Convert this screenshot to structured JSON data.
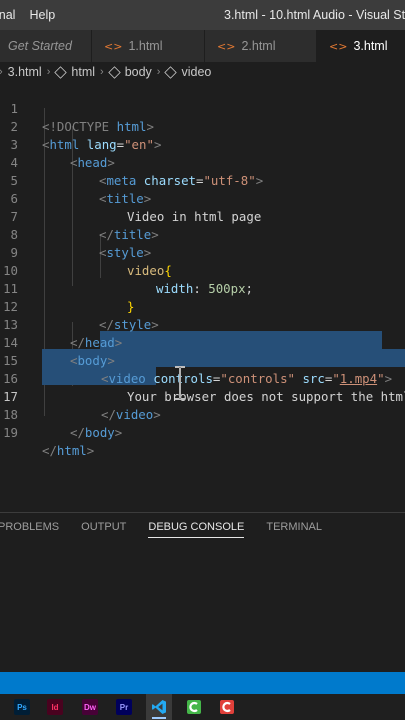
{
  "titlebar": {
    "menu": [
      "inal",
      "Help"
    ],
    "window_title": "3.html - 10.html Audio - Visual Studi"
  },
  "tabs": [
    {
      "label": "Get Started",
      "active": false
    },
    {
      "label": "1.html",
      "active": false
    },
    {
      "label": "2.html",
      "active": false
    },
    {
      "label": "3.html",
      "active": true
    }
  ],
  "breadcrumb": [
    "3.html",
    "html",
    "body",
    "video"
  ],
  "editor": {
    "current_line": "17",
    "line_numbers": [
      "1",
      "2",
      "3",
      "4",
      "5",
      "6",
      "7",
      "8",
      "9",
      "10",
      "11",
      "12",
      "13",
      "14",
      "15",
      "16",
      "17",
      "18",
      "19"
    ],
    "lines": {
      "l1": [
        "<!DOCTYPE ",
        "html",
        ">"
      ],
      "l2": [
        "<",
        "html",
        " lang",
        "=",
        "\"en\"",
        ">"
      ],
      "l3": [
        "<",
        "head",
        ">"
      ],
      "l4": [
        "<",
        "meta",
        " charset",
        "=",
        "\"utf-8\"",
        ">"
      ],
      "l5": [
        "<",
        "title",
        ">"
      ],
      "l6": "Video in html page",
      "l7": [
        "</",
        "title",
        ">"
      ],
      "l8": [
        "<",
        "style",
        ">"
      ],
      "l9": [
        "video",
        "{"
      ],
      "l10": [
        "width",
        ": ",
        "500px",
        ";"
      ],
      "l11": "}",
      "l12": [
        "</",
        "style",
        ">"
      ],
      "l13": [
        "</",
        "head",
        ">"
      ],
      "l14": [
        "<",
        "body",
        ">"
      ],
      "l15": [
        "<",
        "video",
        " controls",
        "=",
        "\"controls\"",
        " src",
        "=",
        "\"",
        "1.mp4",
        "\"",
        ">"
      ],
      "l16": "Your browser does not support the html",
      "l17": [
        "</",
        "video",
        ">"
      ],
      "l18": [
        "</",
        "body",
        ">"
      ],
      "l19": [
        "</",
        "html",
        ">"
      ]
    }
  },
  "panel": {
    "tabs": [
      "PROBLEMS",
      "OUTPUT",
      "DEBUG CONSOLE",
      "TERMINAL"
    ],
    "active_tab": "DEBUG CONSOLE"
  },
  "taskbar": {
    "apps": [
      {
        "name": "Ps",
        "color": "#31a8ff",
        "bg": "#001e36"
      },
      {
        "name": "Id",
        "color": "#ff3366",
        "bg": "#49021f"
      },
      {
        "name": "Dw",
        "color": "#ff61f6",
        "bg": "#470137"
      },
      {
        "name": "Pr",
        "color": "#9999ff",
        "bg": "#00005b"
      }
    ]
  },
  "colors": {
    "accent": "#007acc",
    "selection": "#264f78",
    "tag": "#569cd6",
    "attr": "#9cdcfe",
    "string": "#ce9178"
  }
}
